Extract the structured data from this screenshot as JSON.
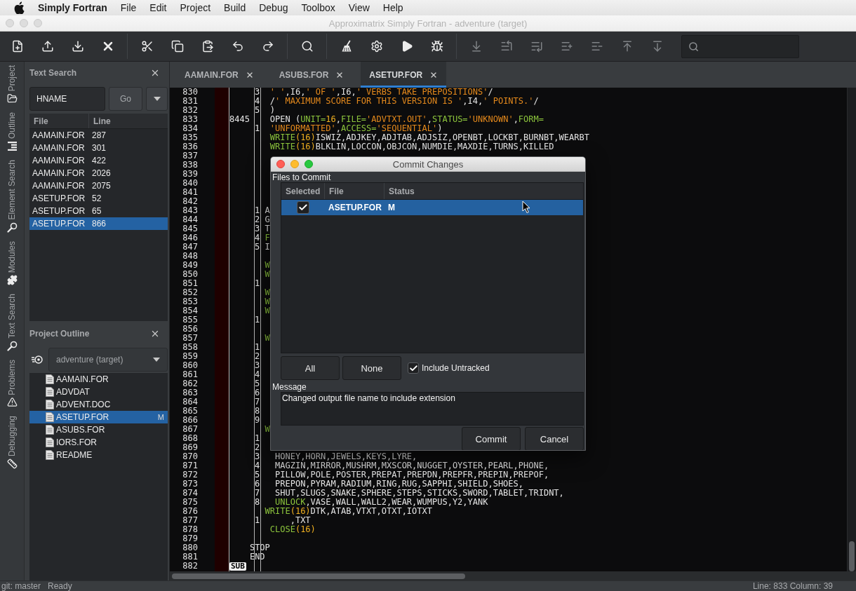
{
  "menu_bar": {
    "app_name": "Simply Fortran",
    "items": [
      "File",
      "Edit",
      "Project",
      "Build",
      "Debug",
      "Toolbox",
      "View",
      "Help"
    ]
  },
  "window": {
    "title": "Approximatrix Simply Fortran - adventure (target)",
    "active": false
  },
  "toolbar": {
    "groups": [
      [
        {
          "disabled": false
        },
        {
          "disabled": false
        },
        {
          "disabled": false
        },
        {
          "disabled": false
        }
      ],
      [
        {
          "disabled": false
        },
        {
          "disabled": false
        },
        {
          "disabled": false
        },
        {
          "disabled": false
        },
        {
          "disabled": false
        }
      ],
      [
        {
          "disabled": false
        }
      ],
      [
        {
          "disabled": false
        },
        {
          "disabled": false
        },
        {
          "disabled": false
        },
        {
          "disabled": false
        }
      ],
      [
        {
          "disabled": true
        },
        {
          "disabled": true
        },
        {
          "disabled": true
        },
        {
          "disabled": true
        },
        {
          "disabled": true
        },
        {
          "disabled": true
        },
        {
          "disabled": true
        }
      ]
    ]
  },
  "side_tabs": [
    {
      "label": "Project"
    },
    {
      "label": "Outline"
    },
    {
      "label": "Element Search"
    },
    {
      "label": "Modules"
    },
    {
      "label": "Text Search"
    },
    {
      "label": "Problems"
    },
    {
      "label": "Debugging"
    }
  ],
  "text_search": {
    "title": "Text Search",
    "query": "HNAME",
    "go_button": "Go",
    "columns": [
      "File",
      "Line"
    ],
    "results": [
      {
        "file": "AAMAIN.FOR",
        "line": "287",
        "selected": false
      },
      {
        "file": "AAMAIN.FOR",
        "line": "301",
        "selected": false
      },
      {
        "file": "AAMAIN.FOR",
        "line": "422",
        "selected": false
      },
      {
        "file": "AAMAIN.FOR",
        "line": "2026",
        "selected": false
      },
      {
        "file": "AAMAIN.FOR",
        "line": "2075",
        "selected": false
      },
      {
        "file": "ASETUP.FOR",
        "line": "52",
        "selected": false
      },
      {
        "file": "ASETUP.FOR",
        "line": "65",
        "selected": false
      },
      {
        "file": "ASETUP.FOR",
        "line": "866",
        "selected": true
      }
    ]
  },
  "project_outline": {
    "title": "Project Outline",
    "target": "adventure (target)",
    "files": [
      {
        "name": "AAMAIN.FOR",
        "selected": false
      },
      {
        "name": "ADVDAT",
        "selected": false
      },
      {
        "name": "ADVENT.DOC",
        "selected": false
      },
      {
        "name": "ASETUP.FOR",
        "selected": true,
        "status": "M"
      },
      {
        "name": "ASUBS.FOR",
        "selected": false
      },
      {
        "name": "IORS.FOR",
        "selected": false
      },
      {
        "name": "README",
        "selected": false
      }
    ]
  },
  "editor": {
    "tabs": [
      {
        "label": "AAMAIN.FOR",
        "selected": false
      },
      {
        "label": "ASUBS.FOR",
        "selected": false
      },
      {
        "label": "ASETUP.FOR",
        "selected": true
      }
    ],
    "lines": [
      {
        "kind": "fixed",
        "number": "830",
        "cont": "3",
        "code": [
          {
            "kind": "string",
            "text": "  ' '"
          },
          {
            "kind": "plain",
            "text": ",I6,"
          },
          {
            "kind": "string",
            "text": "' OF '"
          },
          {
            "kind": "plain",
            "text": ",I6,"
          },
          {
            "kind": "string",
            "text": "' VERBS TAKE PREPOSITIONS'"
          },
          {
            "kind": "plain",
            "text": "/"
          }
        ]
      },
      {
        "kind": "fixed",
        "number": "831",
        "cont": "4",
        "code": [
          {
            "kind": "plain",
            "text": "  /"
          },
          {
            "kind": "string",
            "text": "' MAXIMUM SCORE FOR THIS VERSION IS '"
          },
          {
            "kind": "plain",
            "text": ",I4,"
          },
          {
            "kind": "string",
            "text": "' POINTS.'"
          },
          {
            "kind": "plain",
            "text": "/"
          }
        ]
      },
      {
        "kind": "fixed",
        "number": "832",
        "cont": "5",
        "code": [
          {
            "kind": "plain",
            "text": "  )"
          }
        ]
      },
      {
        "kind": "fixed",
        "number": "833",
        "label": "8445",
        "code": [
          {
            "kind": "plain",
            "text": "  OPEN ("
          },
          {
            "kind": "keyword",
            "text": "UNIT="
          },
          {
            "kind": "number",
            "text": "16"
          },
          {
            "kind": "plain",
            "text": ","
          },
          {
            "kind": "keyword",
            "text": "FILE="
          },
          {
            "kind": "string",
            "text": "'ADVTXT.OUT'"
          },
          {
            "kind": "plain",
            "text": ","
          },
          {
            "kind": "keyword",
            "text": "STATUS="
          },
          {
            "kind": "string",
            "text": "'UNKNOWN'"
          },
          {
            "kind": "plain",
            "text": ","
          },
          {
            "kind": "keyword",
            "text": "FORM="
          }
        ]
      },
      {
        "kind": "fixed",
        "number": "834",
        "cont": "1",
        "code": [
          {
            "kind": "string",
            "text": "  'UNFORMATTED'"
          },
          {
            "kind": "plain",
            "text": ","
          },
          {
            "kind": "keyword",
            "text": "ACCESS="
          },
          {
            "kind": "string",
            "text": "'SEQUENTIAL'"
          },
          {
            "kind": "plain",
            "text": ")"
          }
        ]
      },
      {
        "kind": "fixed",
        "number": "835",
        "code": [
          {
            "kind": "keyword",
            "text": "  WRITE"
          },
          {
            "kind": "number",
            "text": "(16)"
          },
          {
            "kind": "plain",
            "text": "ISWIZ,ADJKEY,ADJTAB,ADJSIZ,OPENBT,LOCKBT,BURNBT,WEARBT"
          }
        ]
      },
      {
        "kind": "fixed",
        "number": "836",
        "code": [
          {
            "kind": "keyword",
            "text": "  WRITE"
          },
          {
            "kind": "number",
            "text": "(16)"
          },
          {
            "kind": "plain",
            "text": "BLKLIN,LOCCON,OBJCON,NUMDIE,MAXDIE,TURNS,KILLED"
          }
        ]
      },
      {
        "kind": "fixed",
        "number": "837"
      },
      {
        "kind": "fixed",
        "number": "838"
      },
      {
        "kind": "fixed",
        "number": "839"
      },
      {
        "kind": "fixed",
        "number": "840"
      },
      {
        "kind": "fixed",
        "number": "841"
      },
      {
        "kind": "fixed",
        "number": "842"
      },
      {
        "kind": "fixed",
        "number": "843",
        "cont": "1",
        "code": [
          {
            "kind": "plain",
            "text": " A"
          }
        ]
      },
      {
        "kind": "fixed",
        "number": "844",
        "cont": "2",
        "code": [
          {
            "kind": "plain",
            "text": " G"
          }
        ]
      },
      {
        "kind": "fixed",
        "number": "845",
        "cont": "3",
        "code": [
          {
            "kind": "plain",
            "text": " T"
          }
        ]
      },
      {
        "kind": "fixed",
        "number": "846",
        "cont": "4",
        "code": [
          {
            "kind": "keyword",
            "text": " F"
          }
        ]
      },
      {
        "kind": "fixed",
        "number": "847",
        "cont": "5",
        "code": [
          {
            "kind": "plain",
            "text": " I"
          }
        ]
      },
      {
        "kind": "fixed",
        "number": "848"
      },
      {
        "kind": "fixed",
        "number": "849",
        "code": [
          {
            "kind": "keyword",
            "text": " W"
          }
        ]
      },
      {
        "kind": "fixed",
        "number": "850",
        "code": [
          {
            "kind": "keyword",
            "text": " W"
          }
        ]
      },
      {
        "kind": "fixed",
        "number": "851",
        "cont": "1"
      },
      {
        "kind": "fixed",
        "number": "852",
        "code": [
          {
            "kind": "keyword",
            "text": " W"
          }
        ]
      },
      {
        "kind": "fixed",
        "number": "853",
        "code": [
          {
            "kind": "keyword",
            "text": " W"
          }
        ]
      },
      {
        "kind": "fixed",
        "number": "854",
        "code": [
          {
            "kind": "keyword",
            "text": " W"
          }
        ]
      },
      {
        "kind": "fixed",
        "number": "855",
        "cont": "1"
      },
      {
        "kind": "fixed",
        "number": "856"
      },
      {
        "kind": "fixed",
        "number": "857",
        "code": [
          {
            "kind": "keyword",
            "text": " W"
          }
        ]
      },
      {
        "kind": "fixed",
        "number": "858",
        "cont": "1"
      },
      {
        "kind": "fixed",
        "number": "859",
        "cont": "2"
      },
      {
        "kind": "fixed",
        "number": "860",
        "cont": "3"
      },
      {
        "kind": "fixed",
        "number": "861",
        "cont": "4"
      },
      {
        "kind": "fixed",
        "number": "862",
        "cont": "5"
      },
      {
        "kind": "fixed",
        "number": "863",
        "cont": "6"
      },
      {
        "kind": "fixed",
        "number": "864",
        "cont": "7"
      },
      {
        "kind": "fixed",
        "number": "865",
        "cont": "8"
      },
      {
        "kind": "fixed",
        "number": "866",
        "cont": "9"
      },
      {
        "kind": "fixed",
        "number": "867",
        "code": [
          {
            "kind": "keyword",
            "text": " W"
          }
        ]
      },
      {
        "kind": "fixed",
        "number": "868",
        "cont": "1"
      },
      {
        "kind": "fixed",
        "number": "869",
        "cont": "2"
      },
      {
        "kind": "fixed",
        "number": "870",
        "cont": "3",
        "code": [
          {
            "kind": "plain",
            "text": "   HONEY,HORN,JEWELS,KEYS,LYRE,"
          }
        ]
      },
      {
        "kind": "fixed",
        "number": "871",
        "cont": "4",
        "code": [
          {
            "kind": "plain",
            "text": "   MAGZIN,MIRROR,MUSHRM,MXSCOR,NUGGET,OYSTER,PEARL,PHONE,"
          }
        ]
      },
      {
        "kind": "fixed",
        "number": "872",
        "cont": "5",
        "code": [
          {
            "kind": "plain",
            "text": "   PILLOW,POLE,POSTER,PREPAT,PREPDN,PREPFR,PREPIN,PREPOF,"
          }
        ]
      },
      {
        "kind": "fixed",
        "number": "873",
        "cont": "6",
        "code": [
          {
            "kind": "plain",
            "text": "   PREPON,PYRAM,RADIUM,RING,RUG,SAPPHI,SHIELD,SHOES,"
          }
        ]
      },
      {
        "kind": "fixed",
        "number": "874",
        "cont": "7",
        "code": [
          {
            "kind": "plain",
            "text": "   SHUT,SLUGS,SNAKE,SPHERE,STEPS,STICKS,SWORD,TABLET,TRIDNT,"
          }
        ]
      },
      {
        "kind": "fixed",
        "number": "875",
        "cont": "8",
        "code": [
          {
            "kind": "keyword",
            "text": "   UNLOCK"
          },
          {
            "kind": "plain",
            "text": ",VASE,WALL,WALL2,WEAR,WUMPUS,Y2,YANK"
          }
        ]
      },
      {
        "kind": "fixed",
        "number": "876",
        "code": [
          {
            "kind": "keyword",
            "text": " WRITE"
          },
          {
            "kind": "number",
            "text": "(16)"
          },
          {
            "kind": "plain",
            "text": "DTK,ATAB,VTXT,OTXT,IOTXT"
          }
        ]
      },
      {
        "kind": "fixed",
        "number": "877",
        "cont": "1",
        "code": [
          {
            "kind": "plain",
            "text": "      ,TXT"
          }
        ]
      },
      {
        "kind": "fixed",
        "number": "878",
        "code": [
          {
            "kind": "keyword",
            "text": "  CLOSE"
          },
          {
            "kind": "number",
            "text": "(16)"
          }
        ]
      },
      {
        "kind": "fixed",
        "number": "879"
      },
      {
        "kind": "tab",
        "number": "880",
        "code": [
          {
            "kind": "plain",
            "text": "    STOP"
          }
        ]
      },
      {
        "kind": "tab",
        "number": "881",
        "code": [
          {
            "kind": "plain",
            "text": "    END"
          }
        ]
      },
      {
        "kind": "control",
        "number": "882",
        "text": "SUB"
      }
    ]
  },
  "commit_dialog": {
    "title": "Commit Changes",
    "active": true,
    "files_label": "Files to Commit",
    "columns": [
      "Selected",
      "File",
      "Status"
    ],
    "rows": [
      {
        "checked": true,
        "file": "ASETUP.FOR",
        "status": "M",
        "selected": true
      }
    ],
    "select_all": "All",
    "select_none": "None",
    "include_untracked": {
      "label": "Include Untracked",
      "checked": true
    },
    "message_label": "Message",
    "message": "Changed output file name to include extension",
    "buttons": [
      "Commit",
      "Cancel"
    ]
  },
  "status_bar": {
    "branch": "git: master",
    "state": "Ready",
    "position": "Line: 833 Column: 39"
  }
}
